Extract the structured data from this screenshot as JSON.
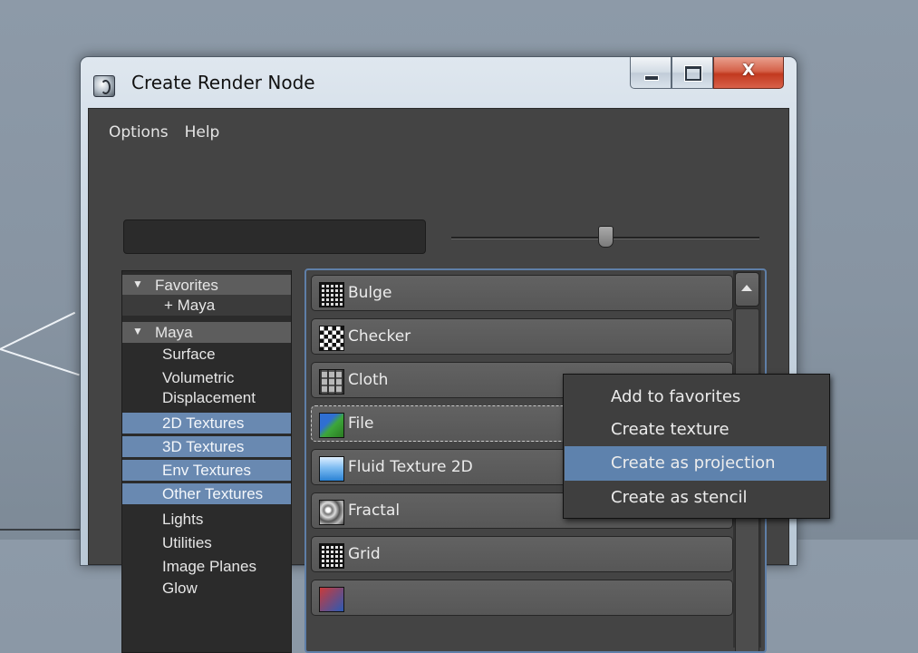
{
  "window": {
    "title": "Create Render Node",
    "close_glyph": "X",
    "buttons": [
      "minimize-icon",
      "maximize-icon",
      "close-icon"
    ]
  },
  "menu": [
    "Options",
    "Help"
  ],
  "search": {
    "value": "",
    "placeholder": ""
  },
  "tree": {
    "items": [
      {
        "label": "Favorites",
        "kind": "header",
        "arrow": "▼"
      },
      {
        "label": "+ Maya",
        "kind": "sub"
      },
      {
        "label": "Maya",
        "kind": "header",
        "arrow": "▼"
      },
      {
        "label": "Surface",
        "kind": "item"
      },
      {
        "label": "Volumetric",
        "kind": "item"
      },
      {
        "label": "Displacement",
        "kind": "item"
      },
      {
        "label": "2D Textures",
        "kind": "selected"
      },
      {
        "label": "3D Textures",
        "kind": "selected"
      },
      {
        "label": "Env Textures",
        "kind": "selected"
      },
      {
        "label": "Other Textures",
        "kind": "selected"
      },
      {
        "label": "Lights",
        "kind": "item"
      },
      {
        "label": "Utilities",
        "kind": "item"
      },
      {
        "label": "Image Planes",
        "kind": "item"
      },
      {
        "label": "Glow",
        "kind": "item"
      }
    ]
  },
  "nodes": [
    {
      "label": "Bulge",
      "icon": "bulge-icon"
    },
    {
      "label": "Checker",
      "icon": "checker-icon"
    },
    {
      "label": "Cloth",
      "icon": "cloth-icon"
    },
    {
      "label": "File",
      "icon": "file-icon",
      "focused": true
    },
    {
      "label": "Fluid Texture 2D",
      "icon": "fluid-texture-icon"
    },
    {
      "label": "Fractal",
      "icon": "fractal-icon"
    },
    {
      "label": "Grid",
      "icon": "grid-icon"
    },
    {
      "label": "",
      "icon": "texture-icon"
    }
  ],
  "context_menu": {
    "items": [
      {
        "label": "Add to favorites",
        "active": false
      },
      {
        "label": "Create texture",
        "active": false
      },
      {
        "label": "Create as projection",
        "active": true
      },
      {
        "label": "Create as stencil",
        "active": false
      }
    ]
  },
  "colors": {
    "selection": "#6989b1",
    "menu_highlight": "#5e82ad",
    "panel_bg": "#444444"
  }
}
